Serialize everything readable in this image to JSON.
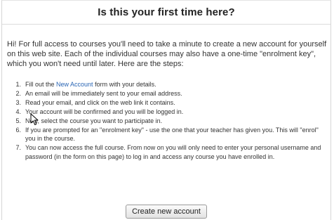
{
  "page": {
    "title": "Is this your first time here?",
    "intro": "Hi! For full access to courses you'll need to take a minute to create a new account for yourself on this web site. Each of the individual courses may also have a one-time \"enrolment key\", which you won't need until later. Here are the steps:"
  },
  "steps": [
    {
      "num": "1.",
      "before": "Fill out the ",
      "link": "New Account",
      "after": " form with your details."
    },
    {
      "num": "2.",
      "text": "An email will be immediately sent to your email address."
    },
    {
      "num": "3.",
      "text": "Read your email, and click on the web link it contains."
    },
    {
      "num": "4.",
      "text": "Your account will be confirmed and you will be logged in."
    },
    {
      "num": "5.",
      "text": "Now, select the course you want to participate in."
    },
    {
      "num": "6.",
      "text": "If you are prompted for an \"enrolment key\" - use the one that your teacher has given you. This will \"enrol\" you in the course."
    },
    {
      "num": "7.",
      "text": "You can now access the full course. From now on you will only need to enter your personal username and password (in the form on this page) to log in and access any course you have enrolled in."
    }
  ],
  "actions": {
    "create_account_label": "Create new account"
  },
  "colors": {
    "link": "#2a66b5",
    "text": "#333333"
  },
  "icons": {
    "cursor": "mouse-pointer-icon"
  }
}
